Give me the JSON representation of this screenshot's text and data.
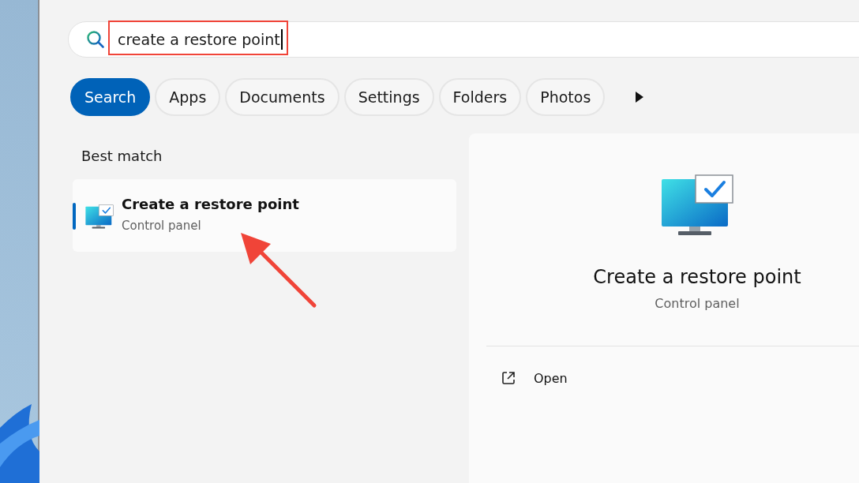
{
  "search": {
    "value": "create a restore point"
  },
  "filters": [
    {
      "label": "Search",
      "selected": true
    },
    {
      "label": "Apps",
      "selected": false
    },
    {
      "label": "Documents",
      "selected": false
    },
    {
      "label": "Settings",
      "selected": false
    },
    {
      "label": "Folders",
      "selected": false
    },
    {
      "label": "Photos",
      "selected": false
    }
  ],
  "results": {
    "heading": "Best match",
    "items": [
      {
        "title": "Create a restore point",
        "subtitle": "Control panel",
        "selected": true
      }
    ]
  },
  "details": {
    "title": "Create a restore point",
    "subtitle": "Control panel",
    "actions": [
      {
        "label": "Open"
      }
    ]
  }
}
